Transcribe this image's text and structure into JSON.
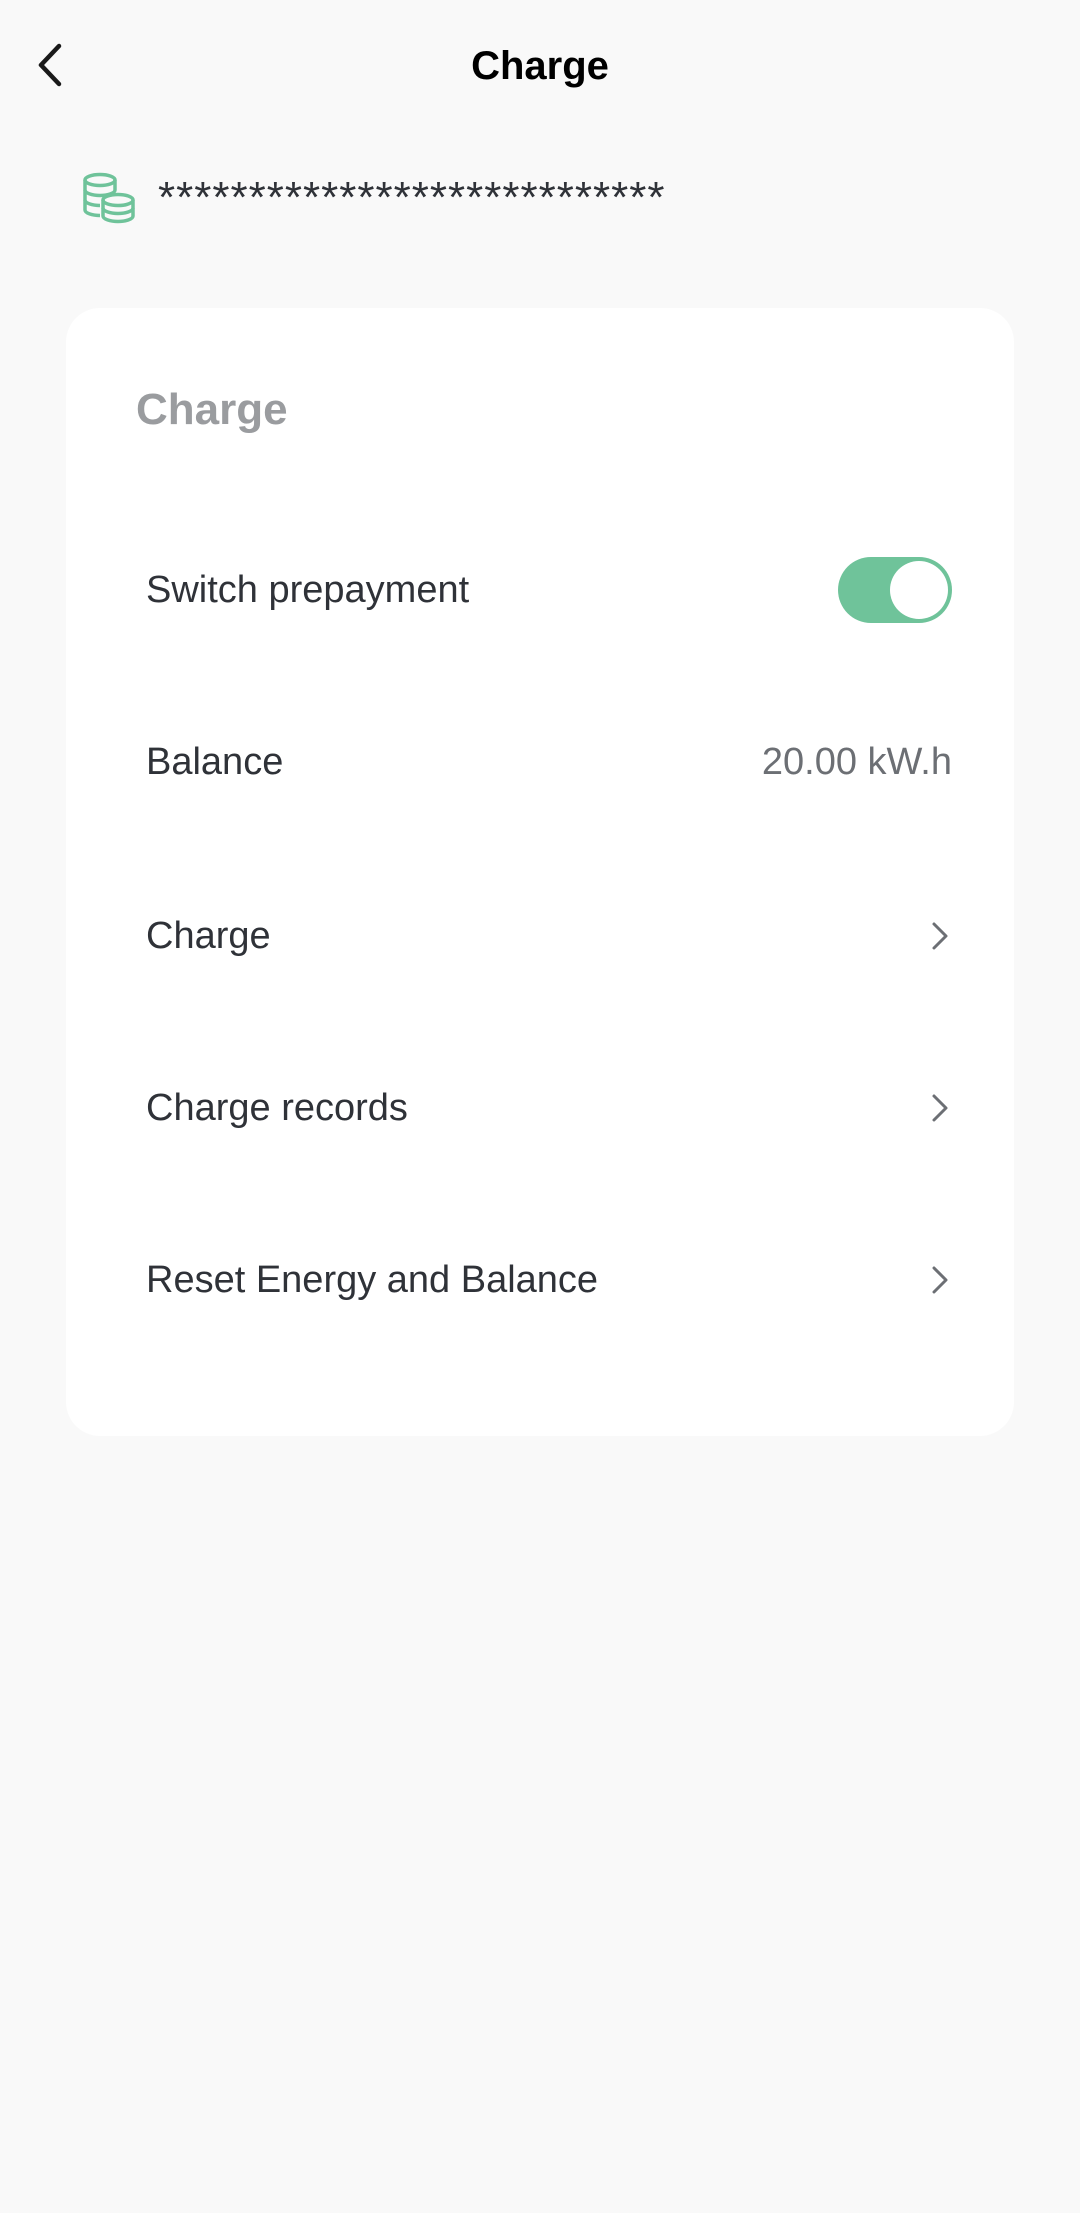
{
  "header": {
    "title": "Charge",
    "back_icon": "chevron-left-icon"
  },
  "device": {
    "icon": "coins-icon",
    "icon_color": "#6fc39a",
    "id_masked": "****************************"
  },
  "card": {
    "title": "Charge",
    "rows": [
      {
        "label": "Switch prepayment",
        "type": "toggle",
        "checked": true
      },
      {
        "label": "Balance",
        "type": "value",
        "value": "20.00 kW.h"
      },
      {
        "label": "Charge",
        "type": "link",
        "icon": "chevron-right-icon"
      },
      {
        "label": "Charge records",
        "type": "link",
        "icon": "chevron-right-icon"
      },
      {
        "label": "Reset Energy and Balance",
        "type": "link",
        "icon": "chevron-right-icon"
      }
    ]
  },
  "colors": {
    "accent": "#6fc39a",
    "background": "#f9f9f9",
    "card": "#ffffff"
  }
}
